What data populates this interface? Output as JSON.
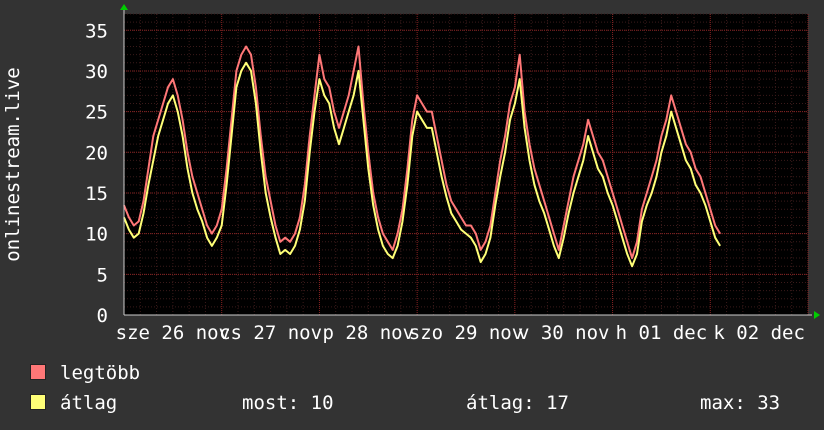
{
  "chart_data": {
    "type": "line",
    "ylabel": "onlinestream.live",
    "ylim": [
      0,
      37
    ],
    "yticks": [
      0,
      5,
      10,
      15,
      20,
      25,
      30,
      35
    ],
    "x_ticks": [
      "sze 26 nov",
      "cs 27 nov",
      "p 28 nov",
      "szo 29 nov",
      "v 30 nov",
      "h 01 dec",
      "k 02 dec"
    ],
    "x_tick_positions": [
      0.5,
      1.5,
      2.5,
      3.5,
      4.5,
      5.5,
      6.5
    ],
    "x_range_days": [
      0,
      7
    ],
    "grid": true,
    "colors": {
      "legtobb": "#ff7777",
      "atlag": "#ffff77",
      "background": "#333333",
      "plot": "#000000",
      "grid": "#882222",
      "axis_arrow": "#00cc00"
    },
    "series": [
      {
        "name": "legtöbb",
        "points": [
          [
            0.0,
            13.5
          ],
          [
            0.05,
            12
          ],
          [
            0.1,
            11
          ],
          [
            0.15,
            11.5
          ],
          [
            0.2,
            14
          ],
          [
            0.25,
            18
          ],
          [
            0.3,
            22
          ],
          [
            0.35,
            24
          ],
          [
            0.4,
            26
          ],
          [
            0.45,
            28
          ],
          [
            0.5,
            29
          ],
          [
            0.55,
            27
          ],
          [
            0.6,
            24
          ],
          [
            0.65,
            20
          ],
          [
            0.7,
            17
          ],
          [
            0.75,
            15
          ],
          [
            0.8,
            13
          ],
          [
            0.85,
            11
          ],
          [
            0.9,
            10
          ],
          [
            0.95,
            11
          ],
          [
            1.0,
            13
          ],
          [
            1.05,
            18
          ],
          [
            1.1,
            24
          ],
          [
            1.15,
            30
          ],
          [
            1.2,
            32
          ],
          [
            1.25,
            33
          ],
          [
            1.3,
            32
          ],
          [
            1.35,
            28
          ],
          [
            1.4,
            22
          ],
          [
            1.45,
            17
          ],
          [
            1.5,
            14
          ],
          [
            1.55,
            11
          ],
          [
            1.6,
            9
          ],
          [
            1.65,
            9.5
          ],
          [
            1.7,
            9
          ],
          [
            1.75,
            10
          ],
          [
            1.8,
            12
          ],
          [
            1.85,
            16
          ],
          [
            1.9,
            22
          ],
          [
            1.95,
            27
          ],
          [
            2.0,
            32
          ],
          [
            2.05,
            29
          ],
          [
            2.1,
            28
          ],
          [
            2.15,
            25
          ],
          [
            2.2,
            23
          ],
          [
            2.25,
            25
          ],
          [
            2.3,
            27
          ],
          [
            2.35,
            30
          ],
          [
            2.4,
            33
          ],
          [
            2.45,
            26
          ],
          [
            2.5,
            20
          ],
          [
            2.55,
            15
          ],
          [
            2.6,
            12
          ],
          [
            2.65,
            10
          ],
          [
            2.7,
            9
          ],
          [
            2.75,
            8
          ],
          [
            2.8,
            10
          ],
          [
            2.85,
            13
          ],
          [
            2.9,
            18
          ],
          [
            2.95,
            24
          ],
          [
            3.0,
            27
          ],
          [
            3.05,
            26
          ],
          [
            3.1,
            25
          ],
          [
            3.15,
            25
          ],
          [
            3.2,
            22
          ],
          [
            3.25,
            19
          ],
          [
            3.3,
            16
          ],
          [
            3.35,
            14
          ],
          [
            3.4,
            13
          ],
          [
            3.45,
            12
          ],
          [
            3.5,
            11
          ],
          [
            3.55,
            11
          ],
          [
            3.6,
            10
          ],
          [
            3.65,
            8
          ],
          [
            3.7,
            9
          ],
          [
            3.75,
            11
          ],
          [
            3.8,
            15
          ],
          [
            3.85,
            19
          ],
          [
            3.9,
            22
          ],
          [
            3.95,
            26
          ],
          [
            4.0,
            28
          ],
          [
            4.05,
            32
          ],
          [
            4.1,
            25
          ],
          [
            4.15,
            21
          ],
          [
            4.2,
            18
          ],
          [
            4.25,
            16
          ],
          [
            4.3,
            14
          ],
          [
            4.35,
            12
          ],
          [
            4.4,
            10
          ],
          [
            4.45,
            8
          ],
          [
            4.5,
            11
          ],
          [
            4.55,
            14
          ],
          [
            4.6,
            17
          ],
          [
            4.65,
            19
          ],
          [
            4.7,
            21
          ],
          [
            4.75,
            24
          ],
          [
            4.8,
            22
          ],
          [
            4.85,
            20
          ],
          [
            4.9,
            19
          ],
          [
            4.95,
            17
          ],
          [
            5.0,
            15
          ],
          [
            5.05,
            13
          ],
          [
            5.1,
            11
          ],
          [
            5.15,
            9
          ],
          [
            5.2,
            7
          ],
          [
            5.25,
            9
          ],
          [
            5.3,
            13
          ],
          [
            5.35,
            15
          ],
          [
            5.4,
            17
          ],
          [
            5.45,
            19
          ],
          [
            5.5,
            22
          ],
          [
            5.55,
            24
          ],
          [
            5.6,
            27
          ],
          [
            5.65,
            25
          ],
          [
            5.7,
            23
          ],
          [
            5.75,
            21
          ],
          [
            5.8,
            20
          ],
          [
            5.85,
            18
          ],
          [
            5.9,
            17
          ],
          [
            5.95,
            15
          ],
          [
            6.0,
            13
          ],
          [
            6.05,
            11
          ],
          [
            6.1,
            10
          ]
        ]
      },
      {
        "name": "átlag",
        "points": [
          [
            0.0,
            12
          ],
          [
            0.05,
            10.5
          ],
          [
            0.1,
            9.5
          ],
          [
            0.15,
            10
          ],
          [
            0.2,
            12.5
          ],
          [
            0.25,
            16
          ],
          [
            0.3,
            19
          ],
          [
            0.35,
            22
          ],
          [
            0.4,
            24
          ],
          [
            0.45,
            26
          ],
          [
            0.5,
            27
          ],
          [
            0.55,
            25
          ],
          [
            0.6,
            22
          ],
          [
            0.65,
            18
          ],
          [
            0.7,
            15
          ],
          [
            0.75,
            13
          ],
          [
            0.8,
            11.5
          ],
          [
            0.85,
            9.5
          ],
          [
            0.9,
            8.5
          ],
          [
            0.95,
            9.5
          ],
          [
            1.0,
            11
          ],
          [
            1.05,
            16
          ],
          [
            1.1,
            22
          ],
          [
            1.15,
            28
          ],
          [
            1.2,
            30
          ],
          [
            1.25,
            31
          ],
          [
            1.3,
            30
          ],
          [
            1.35,
            26
          ],
          [
            1.4,
            20
          ],
          [
            1.45,
            15
          ],
          [
            1.5,
            12
          ],
          [
            1.55,
            9.5
          ],
          [
            1.6,
            7.5
          ],
          [
            1.65,
            8
          ],
          [
            1.7,
            7.5
          ],
          [
            1.75,
            8.5
          ],
          [
            1.8,
            10.5
          ],
          [
            1.85,
            14
          ],
          [
            1.9,
            20
          ],
          [
            1.95,
            25
          ],
          [
            2.0,
            29
          ],
          [
            2.05,
            27
          ],
          [
            2.1,
            26
          ],
          [
            2.15,
            23
          ],
          [
            2.2,
            21
          ],
          [
            2.25,
            23
          ],
          [
            2.3,
            25
          ],
          [
            2.35,
            27
          ],
          [
            2.4,
            30
          ],
          [
            2.45,
            24
          ],
          [
            2.5,
            18
          ],
          [
            2.55,
            13.5
          ],
          [
            2.6,
            10.5
          ],
          [
            2.65,
            8.5
          ],
          [
            2.7,
            7.5
          ],
          [
            2.75,
            7
          ],
          [
            2.8,
            8.5
          ],
          [
            2.85,
            11.5
          ],
          [
            2.9,
            16
          ],
          [
            2.95,
            22
          ],
          [
            3.0,
            25
          ],
          [
            3.05,
            24
          ],
          [
            3.1,
            23
          ],
          [
            3.15,
            23
          ],
          [
            3.2,
            20
          ],
          [
            3.25,
            17
          ],
          [
            3.3,
            14.5
          ],
          [
            3.35,
            12.5
          ],
          [
            3.4,
            11.5
          ],
          [
            3.45,
            10.5
          ],
          [
            3.5,
            10
          ],
          [
            3.55,
            9.5
          ],
          [
            3.6,
            8.5
          ],
          [
            3.65,
            6.5
          ],
          [
            3.7,
            7.5
          ],
          [
            3.75,
            9.5
          ],
          [
            3.8,
            13.5
          ],
          [
            3.85,
            17
          ],
          [
            3.9,
            20
          ],
          [
            3.95,
            24
          ],
          [
            4.0,
            26
          ],
          [
            4.05,
            29
          ],
          [
            4.1,
            23
          ],
          [
            4.15,
            19
          ],
          [
            4.2,
            16
          ],
          [
            4.25,
            14
          ],
          [
            4.3,
            12.5
          ],
          [
            4.35,
            10.5
          ],
          [
            4.4,
            8.5
          ],
          [
            4.45,
            7
          ],
          [
            4.5,
            9.5
          ],
          [
            4.55,
            12.5
          ],
          [
            4.6,
            15
          ],
          [
            4.65,
            17
          ],
          [
            4.7,
            19
          ],
          [
            4.75,
            22
          ],
          [
            4.8,
            20
          ],
          [
            4.85,
            18
          ],
          [
            4.9,
            17
          ],
          [
            4.95,
            15
          ],
          [
            5.0,
            13.5
          ],
          [
            5.05,
            11.5
          ],
          [
            5.1,
            9.5
          ],
          [
            5.15,
            7.5
          ],
          [
            5.2,
            6
          ],
          [
            5.25,
            7.5
          ],
          [
            5.3,
            11.5
          ],
          [
            5.35,
            13.5
          ],
          [
            5.4,
            15
          ],
          [
            5.45,
            17
          ],
          [
            5.5,
            20
          ],
          [
            5.55,
            22
          ],
          [
            5.6,
            25
          ],
          [
            5.65,
            23
          ],
          [
            5.7,
            21
          ],
          [
            5.75,
            19
          ],
          [
            5.8,
            18
          ],
          [
            5.85,
            16
          ],
          [
            5.9,
            15
          ],
          [
            5.95,
            13.5
          ],
          [
            6.0,
            11.5
          ],
          [
            6.05,
            9.5
          ],
          [
            6.1,
            8.5
          ]
        ]
      }
    ]
  },
  "legend": {
    "max_label": "legtöbb",
    "avg_label": "átlag",
    "now_text": "most: 10",
    "avg_text": "átlag: 17",
    "max_text": "max: 33"
  }
}
